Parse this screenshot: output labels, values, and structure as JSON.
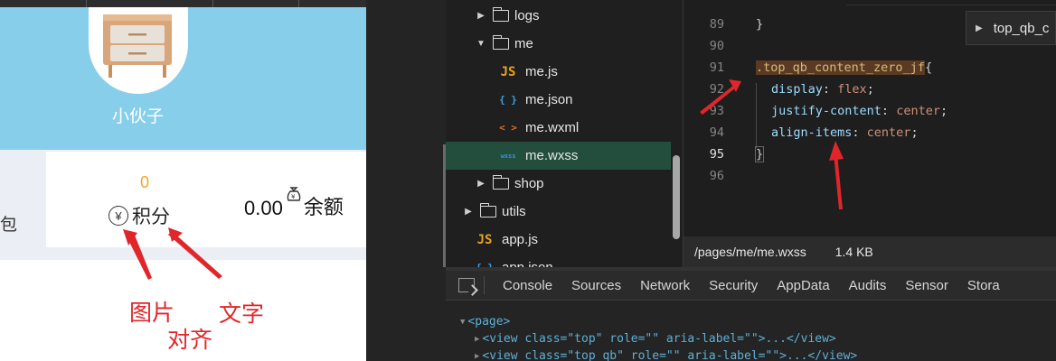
{
  "simulator": {
    "nickname": "小伙子",
    "wallet_partial": "包",
    "points": {
      "value": "0",
      "label": "积分",
      "icon": "yen-circle-icon"
    },
    "balance": {
      "value": "0.00",
      "label": "余额",
      "icon": "money-bag-icon"
    },
    "annotations": {
      "image": "图片",
      "text": "文字",
      "align": "对齐"
    }
  },
  "file_tree": [
    {
      "name": "logs",
      "type": "folder",
      "state": "collapsed"
    },
    {
      "name": "me",
      "type": "folder",
      "state": "expanded"
    },
    {
      "name": "me.js",
      "type": "js",
      "icon": "JS"
    },
    {
      "name": "me.json",
      "type": "json",
      "icon": "{ }"
    },
    {
      "name": "me.wxml",
      "type": "wxml",
      "icon": "< >"
    },
    {
      "name": "me.wxss",
      "type": "wxss",
      "icon": "wxss",
      "selected": true
    },
    {
      "name": "shop",
      "type": "folder",
      "state": "collapsed"
    },
    {
      "name": "utils",
      "type": "folder",
      "state": "collapsed"
    },
    {
      "name": "app.js",
      "type": "js",
      "icon": "JS"
    },
    {
      "name": "app.json",
      "type": "json",
      "icon": "{ }"
    }
  ],
  "editor": {
    "lines": [
      {
        "n": "89",
        "text": "}"
      },
      {
        "n": "90",
        "text": ""
      },
      {
        "n": "91",
        "selector": ".top_qb_content_zero_jf",
        "brace": "{"
      },
      {
        "n": "92",
        "prop": "display",
        "value": "flex"
      },
      {
        "n": "93",
        "prop": "justify-content",
        "value": "center"
      },
      {
        "n": "94",
        "prop": "align-items",
        "value": "center"
      },
      {
        "n": "95",
        "text": "}",
        "active": true
      },
      {
        "n": "96",
        "text": ""
      }
    ],
    "breadcrumb": "top_qb_c",
    "status_path": "/pages/me/me.wxss",
    "status_size": "1.4 KB"
  },
  "devtools_tabs": [
    "Console",
    "Sources",
    "Network",
    "Security",
    "AppData",
    "Audits",
    "Sensor",
    "Stora"
  ],
  "console_lines": [
    "<page>",
    "<view class=\"top\" role=\"\" aria-label=\"\">...</view>",
    "<view class=\"top_qb\" role=\"\" aria-label=\"\">...</view>"
  ],
  "colors": {
    "header_bg": "#87ceeb",
    "annotation": "#e0262a",
    "points_value": "#f6a623",
    "selected_row": "#234e3e"
  }
}
